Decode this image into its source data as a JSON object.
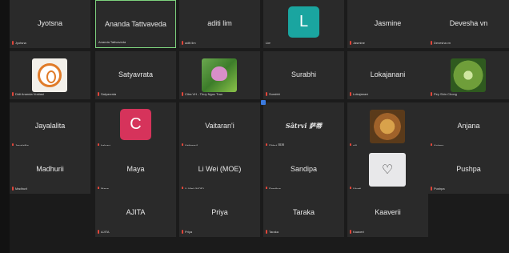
{
  "tiles": [
    {
      "display": "Jyotsna",
      "label": "Jyotsna"
    },
    {
      "display": "Ananda Tattvaveda",
      "label": "Ananda Tattvaveda"
    },
    {
      "display": "aditi lim",
      "label": "aditi lim"
    },
    {
      "display": "",
      "label": "Lim",
      "avatar": "L"
    },
    {
      "display": "Jasmine",
      "label": "Jasmine"
    },
    {
      "display": "Devesha vn",
      "label": "Devesha vn"
    },
    {
      "display": "",
      "label": "Didi Ananda Vratiasi"
    },
    {
      "display": "Satyavrata",
      "label": "Satyavrata"
    },
    {
      "display": "",
      "label": "Citra VH - Thuy Ngoc Tran"
    },
    {
      "display": "Surabhi",
      "label": "Surabhi"
    },
    {
      "display": "Lokajanani",
      "label": "Lokajanani"
    },
    {
      "display": "",
      "label": "Pey Shin Chong"
    },
    {
      "display": "Jayalalita",
      "label": "Jayalalita"
    },
    {
      "display": "",
      "label": "kalyani",
      "avatar": "C"
    },
    {
      "display": "Vaitaran'i",
      "label": "Vaitaran'i"
    },
    {
      "display": "Sâtrvi 萨蒂",
      "label": "Sâtrvi 萨蒂"
    },
    {
      "display": "",
      "label": "ujli"
    },
    {
      "display": "Anjana",
      "label": "Anjana"
    },
    {
      "display": "Madhurii",
      "label": "Madhurii"
    },
    {
      "display": "Maya",
      "label": "Maya"
    },
    {
      "display": "Li Wei (MOE)",
      "label": "Li Wei (MOE)"
    },
    {
      "display": "Sandipa",
      "label": "Sandipa"
    },
    {
      "display": "",
      "label": "Vinati"
    },
    {
      "display": "Pushpa",
      "label": "Pushpa"
    },
    {
      "display": "AJITA",
      "label": "AJITA"
    },
    {
      "display": "Priya",
      "label": "Priya"
    },
    {
      "display": "Taraka",
      "label": "Taraka"
    },
    {
      "display": "Kaaverii",
      "label": "Kaaverii"
    }
  ],
  "colors": {
    "active_border": "#7ed37e",
    "mic_muted": "#e0463a",
    "avatar_L": "#1aa5a0",
    "avatar_C": "#d6335b"
  }
}
